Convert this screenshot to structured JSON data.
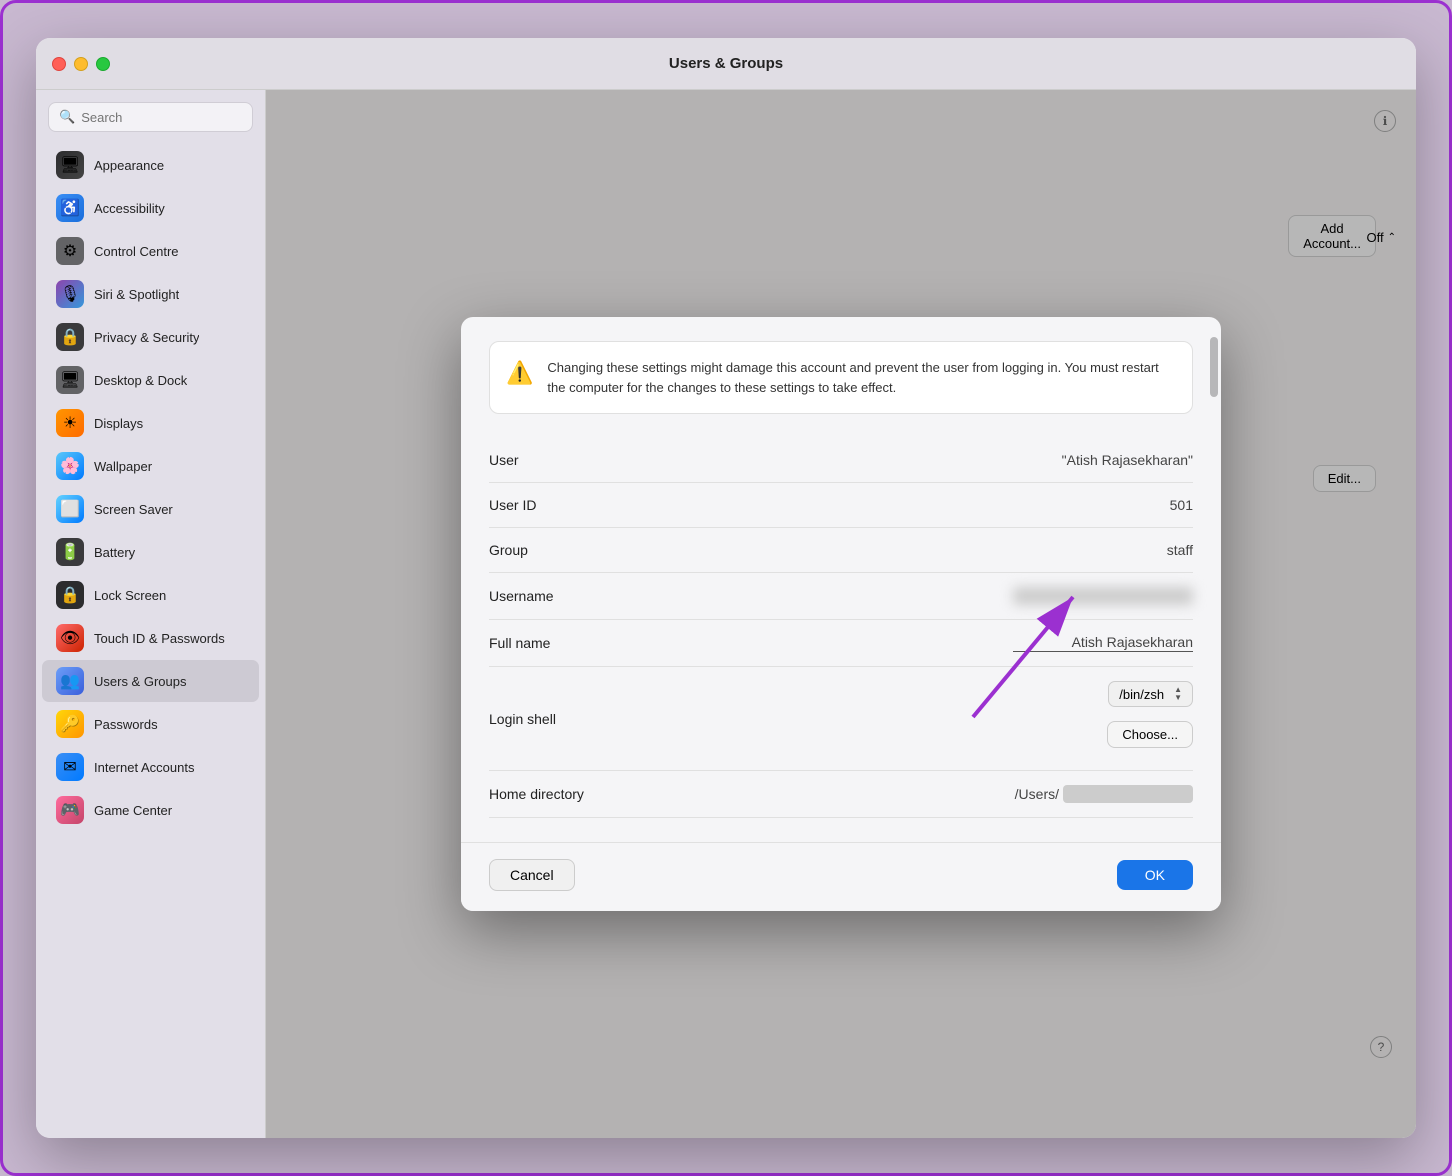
{
  "window": {
    "title": "Users & Groups"
  },
  "traffic_lights": {
    "close": "close",
    "minimize": "minimize",
    "maximize": "maximize"
  },
  "sidebar": {
    "search_placeholder": "Search",
    "items": [
      {
        "id": "appearance",
        "label": "Appearance",
        "icon": "🖥",
        "icon_class": "icon-appearance"
      },
      {
        "id": "accessibility",
        "label": "Accessibility",
        "icon": "♿",
        "icon_class": "icon-accessibility"
      },
      {
        "id": "control",
        "label": "Control Centre",
        "icon": "⚙",
        "icon_class": "icon-control"
      },
      {
        "id": "siri",
        "label": "Siri & Spotlight",
        "icon": "🎙",
        "icon_class": "icon-siri"
      },
      {
        "id": "privacy",
        "label": "Privacy & Security",
        "icon": "🔒",
        "icon_class": "icon-privacy"
      },
      {
        "id": "desktop",
        "label": "Desktop & Dock",
        "icon": "🖥",
        "icon_class": "icon-desktop"
      },
      {
        "id": "displays",
        "label": "Displays",
        "icon": "☀",
        "icon_class": "icon-displays"
      },
      {
        "id": "wallpaper",
        "label": "Wallpaper",
        "icon": "🌸",
        "icon_class": "icon-wallpaper"
      },
      {
        "id": "screensaver",
        "label": "Screen Saver",
        "icon": "⬜",
        "icon_class": "icon-screensaver"
      },
      {
        "id": "battery",
        "label": "Battery",
        "icon": "🔋",
        "icon_class": "icon-battery"
      },
      {
        "id": "lockscreen",
        "label": "Lock Screen",
        "icon": "🔒",
        "icon_class": "icon-lockscreen"
      },
      {
        "id": "touchid",
        "label": "Touch ID & Passwords",
        "icon": "👁",
        "icon_class": "icon-touchid"
      },
      {
        "id": "users",
        "label": "Users & Groups",
        "icon": "👥",
        "icon_class": "icon-users",
        "active": true
      },
      {
        "id": "passwords",
        "label": "Passwords",
        "icon": "🔑",
        "icon_class": "icon-passwords"
      },
      {
        "id": "internet",
        "label": "Internet Accounts",
        "icon": "✉",
        "icon_class": "icon-internet"
      },
      {
        "id": "gamecenter",
        "label": "Game Center",
        "icon": "🎮",
        "icon_class": "icon-gamecenter"
      }
    ]
  },
  "right_panel": {
    "add_account_label": "Add Account...",
    "off_label": "Off",
    "edit_label": "Edit..."
  },
  "modal": {
    "warning_text": "Changing these settings might damage this account and prevent the user from logging in. You must restart the computer for the changes to these settings to take effect.",
    "fields": [
      {
        "label": "User",
        "value": "\"Atish Rajasekharan\"",
        "type": "normal"
      },
      {
        "label": "User ID",
        "value": "501",
        "type": "normal"
      },
      {
        "label": "Group",
        "value": "staff",
        "type": "normal"
      },
      {
        "label": "Username",
        "value": "blurred",
        "type": "blurred"
      },
      {
        "label": "Full name",
        "value": "Atish Rajasekharan",
        "type": "editable"
      },
      {
        "label": "Login shell",
        "value": "/bin/zsh",
        "type": "stepper"
      },
      {
        "label": "Home directory",
        "value": "/Users/",
        "type": "blurred-partial"
      }
    ],
    "choose_label": "Choose...",
    "cancel_label": "Cancel",
    "ok_label": "OK"
  }
}
